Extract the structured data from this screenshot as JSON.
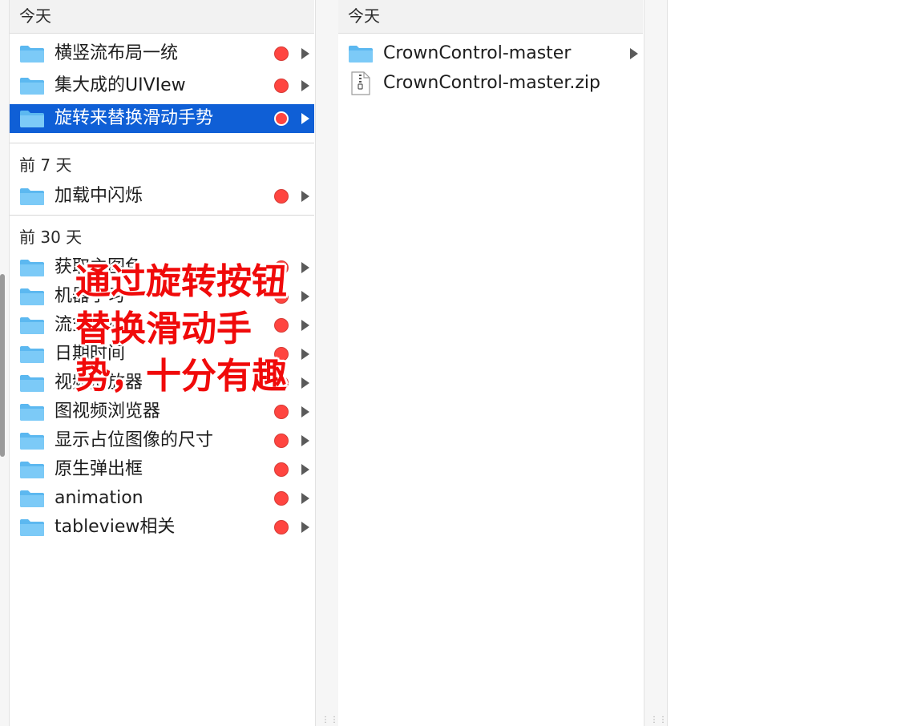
{
  "columns": [
    {
      "sections": [
        {
          "header": "今天",
          "items": [
            {
              "label": "横竖流布局一统",
              "selected": false
            },
            {
              "label": "集大成的UIVIew",
              "selected": false
            },
            {
              "label": "旋转来替换滑动手势",
              "selected": true
            }
          ]
        },
        {
          "header": "前 7 天",
          "items": [
            {
              "label": "加载中闪烁",
              "selected": false
            }
          ]
        },
        {
          "header": "前 30 天",
          "items": [
            {
              "label": "获取主图色",
              "selected": false
            },
            {
              "label": "机器学习",
              "selected": false
            },
            {
              "label": "流式布局",
              "selected": false
            },
            {
              "label": "日期时间",
              "selected": false
            },
            {
              "label": "视频播放器",
              "selected": false
            },
            {
              "label": "图视频浏览器",
              "selected": false
            },
            {
              "label": "显示占位图像的尺寸",
              "selected": false
            },
            {
              "label": "原生弹出框",
              "selected": false
            },
            {
              "label": "animation",
              "selected": false
            },
            {
              "label": "tableview相关",
              "selected": false
            }
          ]
        }
      ]
    },
    {
      "sections": [
        {
          "header": "今天",
          "items": [
            {
              "label": "CrownControl-master",
              "kind": "folder"
            },
            {
              "label": "CrownControl-master.zip",
              "kind": "zip"
            }
          ]
        }
      ]
    }
  ],
  "tag_color": "#ff4540",
  "selection_color": "#0f5fd6",
  "folder_color": "#5cb8f0",
  "overlay": {
    "lines": [
      "通过旋转按钮",
      "替换滑动手",
      "势，十分有趣"
    ],
    "color": "#f00a0a"
  }
}
